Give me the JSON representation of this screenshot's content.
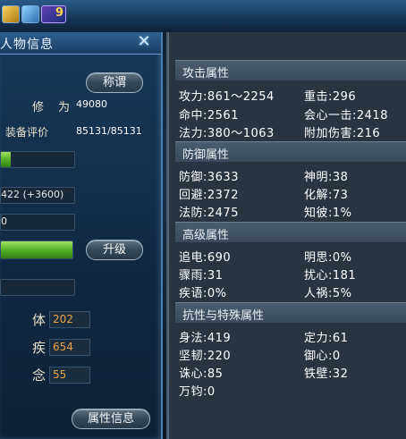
{
  "left": {
    "title": "人物信息",
    "title_button": "称谓",
    "cultivation_label": "修",
    "cultivation_label2": "为",
    "cultivation_value": "49080",
    "equip_label": "装备评价",
    "equip_value": "85131/85131",
    "field_a": "422 (+3600)",
    "field_b": "0",
    "upgrade_button": "升级",
    "stats": [
      {
        "label": "体",
        "value": "202"
      },
      {
        "label": "疾",
        "value": "654"
      },
      {
        "label": "念",
        "value": "55"
      }
    ],
    "attr_button": "属性信息"
  },
  "right": {
    "sections": [
      {
        "title": "攻击属性",
        "rows": [
          [
            "攻力:861～2254",
            "重击:296"
          ],
          [
            "命中:2561",
            "会心一击:2418"
          ],
          [
            "法力:380～1063",
            "附加伤害:216"
          ]
        ]
      },
      {
        "title": "防御属性",
        "rows": [
          [
            "防御:3633",
            "神明:38"
          ],
          [
            "回避:2372",
            "化解:73"
          ],
          [
            "法防:2475",
            "知彼:1%"
          ]
        ]
      },
      {
        "title": "高级属性",
        "rows": [
          [
            "追电:690",
            "明思:0%"
          ],
          [
            "骤雨:31",
            "扰心:181"
          ],
          [
            "疾语:0%",
            "人祸:5%"
          ]
        ]
      },
      {
        "title": "抗性与特殊属性",
        "rows": [
          [
            "身法:419",
            "定力:61"
          ],
          [
            "坚韧:220",
            "御心:0"
          ],
          [
            "诛心:85",
            "铁壁:32"
          ],
          [
            "万钧:0",
            ""
          ]
        ]
      }
    ]
  }
}
